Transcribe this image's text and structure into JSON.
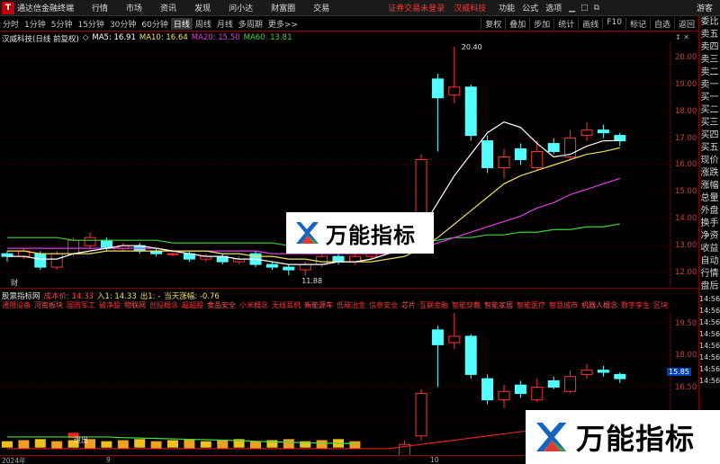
{
  "menubar": {
    "app_title": "通达信金融终端",
    "items": [
      "行情",
      "市场",
      "资讯",
      "发现",
      "问小达",
      "财富圈",
      "交易"
    ],
    "notice": "证券交易未登录",
    "stock_name": "汉威科技",
    "right_items": [
      "功能",
      "公式",
      "选项"
    ],
    "guest": "游客"
  },
  "toolbar": {
    "periods": [
      "分时",
      "1分钟",
      "5分钟",
      "15分钟",
      "30分钟",
      "60分钟",
      "日线",
      "周线",
      "月线",
      "多周期"
    ],
    "active_period": "日线",
    "more": "更多>>",
    "buttons": [
      "复权",
      "叠加",
      "步加",
      "统计",
      "画线",
      "F10",
      "标记",
      "自选",
      "返回"
    ]
  },
  "main_info": {
    "title": "汉威科技(日线 前复权)",
    "ma5": "MA5: 16.91",
    "ma10": "MA10: 16.64",
    "ma20": "MA20: 15.50",
    "ma60": "MA60: 13.81"
  },
  "main_axis": [
    "20.00",
    "19.00",
    "18.00",
    "17.00",
    "16.00",
    "15.00",
    "14.00",
    "13.00",
    "12.00"
  ],
  "main_annotations": {
    "high": "20.40",
    "low": "11.88",
    "fin_mark": "财"
  },
  "indicator_info": {
    "title": "股票指标网",
    "cost": "成本价: 14.33",
    "in1": "入1: 14.33",
    "out1": "出1: -",
    "change": "当天涨幅: -0.76"
  },
  "indicator_labels": [
    "通用设备",
    "河南板块",
    "国防军工",
    "破净股",
    "物联网",
    "创投概念",
    "超超股",
    "食品安全",
    "小米概念",
    "无线耳机",
    "新能源车",
    "低碳冶金",
    "信息安全",
    "芯片",
    "互联金融",
    "智能穿戴",
    "智能家居",
    "智能医疗",
    "智慧城市",
    "机器人概念",
    "数字孪生",
    "区块链"
  ],
  "indicator_axis": [
    "19.50",
    "18.00",
    "16.50",
    "15.00"
  ],
  "indicator_current": "15.85",
  "indicator_annotations": {
    "out_mark": "退出"
  },
  "x_axis": {
    "year": "2024年",
    "m9": "9",
    "m10": "10"
  },
  "sidebar": [
    "委比",
    "卖五",
    "卖四",
    "卖三",
    "卖二",
    "卖一",
    "买一",
    "买二",
    "买三",
    "买四",
    "买五",
    "现价",
    "涨跌",
    "涨幅",
    "总量",
    "外盘",
    "换手",
    "净资",
    "收益",
    "自动",
    "行情",
    "盘后",
    "14:56",
    "14:56",
    "14:56",
    "14:56",
    "14:56",
    "14:56",
    "14:56",
    "14:56"
  ],
  "watermark": {
    "text": "万能指标"
  },
  "chart_data": {
    "type": "candlestick",
    "ylim": [
      11.5,
      20.6
    ],
    "candles": [
      {
        "o": 12.7,
        "c": 12.6,
        "h": 12.8,
        "l": 12.4
      },
      {
        "o": 12.6,
        "c": 12.8,
        "h": 12.9,
        "l": 12.5
      },
      {
        "o": 12.7,
        "c": 12.2,
        "h": 12.8,
        "l": 12.1
      },
      {
        "o": 12.2,
        "c": 12.7,
        "h": 12.8,
        "l": 12.1
      },
      {
        "o": 12.7,
        "c": 13.2,
        "h": 13.3,
        "l": 12.6
      },
      {
        "o": 13.0,
        "c": 13.3,
        "h": 13.5,
        "l": 12.9
      },
      {
        "o": 13.2,
        "c": 12.9,
        "h": 13.3,
        "l": 12.8
      },
      {
        "o": 12.9,
        "c": 13.0,
        "h": 13.1,
        "l": 12.8
      },
      {
        "o": 13.0,
        "c": 12.8,
        "h": 13.1,
        "l": 12.7
      },
      {
        "o": 12.8,
        "c": 12.7,
        "h": 12.9,
        "l": 12.6
      },
      {
        "o": 12.7,
        "c": 12.7,
        "h": 12.8,
        "l": 12.6
      },
      {
        "o": 12.7,
        "c": 12.5,
        "h": 12.8,
        "l": 12.4
      },
      {
        "o": 12.5,
        "c": 12.6,
        "h": 12.7,
        "l": 12.4
      },
      {
        "o": 12.6,
        "c": 12.4,
        "h": 12.7,
        "l": 12.3
      },
      {
        "o": 12.4,
        "c": 12.5,
        "h": 12.6,
        "l": 12.3
      },
      {
        "o": 12.7,
        "c": 12.3,
        "h": 12.8,
        "l": 12.2
      },
      {
        "o": 12.3,
        "c": 12.2,
        "h": 12.4,
        "l": 12.1
      },
      {
        "o": 12.2,
        "c": 12.1,
        "h": 12.3,
        "l": 11.9
      },
      {
        "o": 12.1,
        "c": 12.3,
        "h": 12.4,
        "l": 11.88
      },
      {
        "o": 12.3,
        "c": 12.6,
        "h": 12.7,
        "l": 12.2
      },
      {
        "o": 12.6,
        "c": 12.4,
        "h": 12.7,
        "l": 12.3
      },
      {
        "o": 12.4,
        "c": 12.6,
        "h": 12.8,
        "l": 12.3
      },
      {
        "o": 12.6,
        "c": 12.8,
        "h": 13.0,
        "l": 12.5
      },
      {
        "o": 12.8,
        "c": 13.2,
        "h": 13.3,
        "l": 12.7
      },
      {
        "o": 13.2,
        "c": 13.8,
        "h": 14.0,
        "l": 13.1
      },
      {
        "o": 14.2,
        "c": 16.2,
        "h": 16.4,
        "l": 14.0
      },
      {
        "o": 19.2,
        "c": 18.5,
        "h": 19.4,
        "l": 16.5
      },
      {
        "o": 18.6,
        "c": 18.9,
        "h": 20.4,
        "l": 18.3
      },
      {
        "o": 18.9,
        "c": 17.1,
        "h": 19.0,
        "l": 16.9
      },
      {
        "o": 16.9,
        "c": 15.9,
        "h": 17.1,
        "l": 15.7
      },
      {
        "o": 15.9,
        "c": 16.3,
        "h": 16.6,
        "l": 15.5
      },
      {
        "o": 16.6,
        "c": 16.2,
        "h": 16.8,
        "l": 16.0
      },
      {
        "o": 15.9,
        "c": 16.5,
        "h": 16.9,
        "l": 15.8
      },
      {
        "o": 16.8,
        "c": 16.5,
        "h": 17.0,
        "l": 16.4
      },
      {
        "o": 16.3,
        "c": 17.0,
        "h": 17.3,
        "l": 16.2
      },
      {
        "o": 17.1,
        "c": 17.3,
        "h": 17.6,
        "l": 16.9
      },
      {
        "o": 17.3,
        "c": 17.2,
        "h": 17.5,
        "l": 17.0
      },
      {
        "o": 17.1,
        "c": 16.9,
        "h": 17.2,
        "l": 16.7
      }
    ],
    "ma5": [
      12.6,
      12.6,
      12.5,
      12.5,
      12.7,
      12.8,
      12.9,
      13.0,
      13.0,
      12.9,
      12.8,
      12.7,
      12.6,
      12.6,
      12.5,
      12.5,
      12.4,
      12.3,
      12.3,
      12.3,
      12.4,
      12.4,
      12.5,
      12.7,
      13.0,
      13.6,
      14.6,
      15.6,
      16.4,
      17.2,
      17.6,
      17.4,
      16.8,
      16.3,
      16.4,
      16.7,
      16.9,
      16.91
    ],
    "ma10": [
      12.8,
      12.8,
      12.7,
      12.7,
      12.7,
      12.7,
      12.8,
      12.8,
      12.8,
      12.8,
      12.8,
      12.8,
      12.8,
      12.7,
      12.7,
      12.6,
      12.6,
      12.5,
      12.5,
      12.4,
      12.4,
      12.4,
      12.4,
      12.5,
      12.6,
      12.9,
      13.3,
      13.8,
      14.3,
      14.8,
      15.3,
      15.6,
      15.8,
      16.0,
      16.2,
      16.4,
      16.5,
      16.64
    ],
    "ma20": [
      12.9,
      12.9,
      12.9,
      12.9,
      12.9,
      12.9,
      12.9,
      12.9,
      12.9,
      12.9,
      12.8,
      12.8,
      12.8,
      12.8,
      12.8,
      12.8,
      12.7,
      12.7,
      12.7,
      12.7,
      12.7,
      12.7,
      12.7,
      12.7,
      12.8,
      12.9,
      13.1,
      13.3,
      13.5,
      13.7,
      13.9,
      14.1,
      14.4,
      14.6,
      14.9,
      15.1,
      15.3,
      15.5
    ],
    "ma60": [
      13.3,
      13.3,
      13.3,
      13.3,
      13.2,
      13.2,
      13.2,
      13.2,
      13.2,
      13.2,
      13.1,
      13.1,
      13.1,
      13.1,
      13.1,
      13.1,
      13.1,
      13.0,
      13.0,
      13.0,
      13.0,
      13.0,
      13.0,
      13.0,
      13.1,
      13.1,
      13.2,
      13.3,
      13.3,
      13.4,
      13.4,
      13.5,
      13.5,
      13.6,
      13.6,
      13.7,
      13.7,
      13.81
    ],
    "indicator_ylim": [
      13.3,
      20.0
    ],
    "cost_line": [
      13.6,
      13.6,
      13.6,
      13.6,
      13.6,
      13.6,
      13.6,
      13.6,
      13.6,
      13.6,
      13.6,
      13.6,
      13.6,
      13.6,
      13.6,
      13.6,
      13.6,
      13.6,
      13.6,
      13.6,
      13.6,
      13.6,
      13.6,
      13.6,
      13.7,
      13.8,
      13.9,
      14.0,
      14.1,
      14.2,
      14.3,
      14.4,
      14.5,
      14.6,
      14.7,
      14.8,
      14.9,
      15.0
    ],
    "green_line": [
      14.15,
      14.15,
      14.15,
      14.15,
      14.15,
      14.15,
      14.15,
      14.12,
      14.1,
      14.08,
      14.06,
      14.04,
      14.02,
      14.0,
      13.98,
      13.95,
      13.92,
      13.9,
      13.88,
      13.86,
      13.85,
      13.84
    ]
  }
}
